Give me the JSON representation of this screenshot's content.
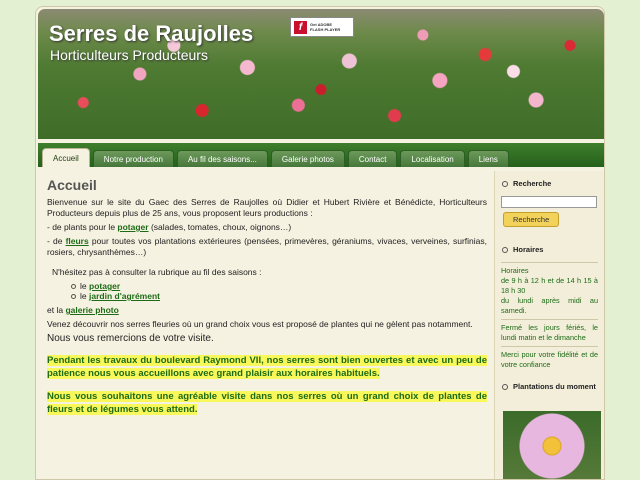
{
  "header": {
    "title": "Serres de Raujolles",
    "subtitle": "Horticulteurs Producteurs",
    "flash_badge": {
      "line1": "Get ADOBE",
      "line2": "FLASH PLAYER",
      "icon": "flash-icon"
    }
  },
  "nav": {
    "tabs": [
      {
        "label": "Accueil",
        "active": true
      },
      {
        "label": "Notre production"
      },
      {
        "label": "Au fil des saisons..."
      },
      {
        "label": "Galerie photos"
      },
      {
        "label": "Contact"
      },
      {
        "label": "Localisation"
      },
      {
        "label": "Liens"
      }
    ]
  },
  "main": {
    "title": "Accueil",
    "intro": "Bienvenue sur le site du Gaec des Serres de Raujolles où Didier et Hubert Rivière et Bénédicte, Horticulteurs Producteurs depuis plus de 25 ans, vous proposent leurs productions :",
    "line1_pre": "- de plants pour le ",
    "line1_link": "potager",
    "line1_post": " (salades, tomates, choux, oignons…)",
    "line2_pre": "- de ",
    "line2_link": "fleurs",
    "line2_post": " pour toutes vos plantations extérieures (pensées, primevères, géraniums, vivaces, verveines, surfinias, rosiers, chrysanthèmes…)",
    "hesitate": "N'hésitez pas à consulter la rubrique au fil des saisons :",
    "list_pre": "le ",
    "season_links": [
      "potager",
      "jardin d'agrément"
    ],
    "gallery_pre": "et la ",
    "gallery_link": "galerie photo",
    "visit": "Venez découvrir nos serres fleuries où un grand choix vous est proposé de plantes qui ne gèlent pas notamment.",
    "thanks": "Nous vous remercions de votre visite.",
    "highlight1": "Pendant les travaux du boulevard Raymond VII, nos serres sont bien ouvertes et avec un peu de patience nous vous accueillons avec grand plaisir aux horaires habituels.",
    "highlight2": "Nous vous souhaitons une agréable visite dans nos serres où un grand choix de plantes de fleurs et de légumes vous attend."
  },
  "sidebar": {
    "search_heading": "Recherche",
    "search_value": "",
    "search_button": "Recherche",
    "hours_heading": "Horaires",
    "hours_label": "Horaires",
    "hours_1": "de 9 h à 12 h et de 14 h 15 à 18 h 30",
    "hours_2": "du lundi après midi au samedi.",
    "hours_3": "Fermé les jours fériés, le lundi matin et le dimanche",
    "hours_4": "Merci pour votre fidélité et de votre confiance",
    "plants_heading": "Plantations du moment"
  }
}
